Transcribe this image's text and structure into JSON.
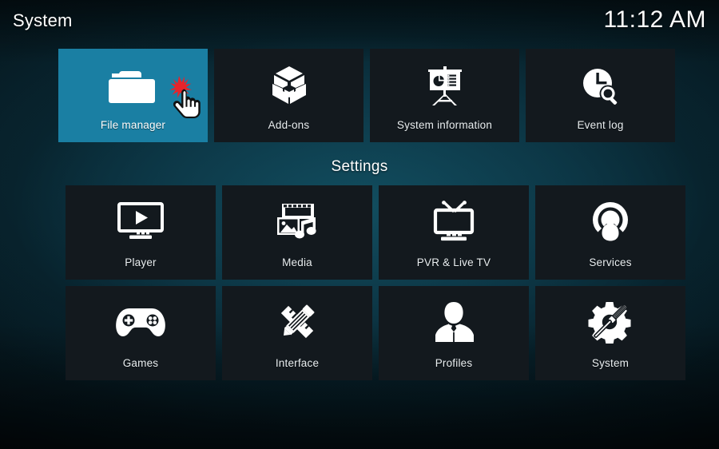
{
  "header": {
    "title": "System",
    "clock": "11:12 AM"
  },
  "colors": {
    "selected_tile": "#1a7fa3",
    "tile": "#13191e",
    "label_text": "#e9eef0",
    "background_center": "#0d3b4a",
    "cursor_click_marker": "#e8232a"
  },
  "top_row": {
    "items": [
      {
        "label": "File manager",
        "icon": "folder-icon",
        "selected": true
      },
      {
        "label": "Add-ons",
        "icon": "open-box-icon",
        "selected": false
      },
      {
        "label": "System information",
        "icon": "presentation-board-icon",
        "selected": false
      },
      {
        "label": "Event log",
        "icon": "clock-magnifier-icon",
        "selected": false
      }
    ]
  },
  "settings_section": {
    "heading": "Settings",
    "rows": [
      [
        {
          "label": "Player",
          "icon": "monitor-play-icon"
        },
        {
          "label": "Media",
          "icon": "film-photo-music-icon"
        },
        {
          "label": "PVR & Live TV",
          "icon": "tv-antenna-icon"
        },
        {
          "label": "Services",
          "icon": "broadcast-person-icon"
        }
      ],
      [
        {
          "label": "Games",
          "icon": "gamepad-icon"
        },
        {
          "label": "Interface",
          "icon": "pencil-ruler-icon"
        },
        {
          "label": "Profiles",
          "icon": "person-bust-icon"
        },
        {
          "label": "System",
          "icon": "gear-screwdriver-icon"
        }
      ]
    ]
  },
  "cursor": {
    "type": "pointing-hand-cursor",
    "click_marker": "click-burst-icon"
  }
}
